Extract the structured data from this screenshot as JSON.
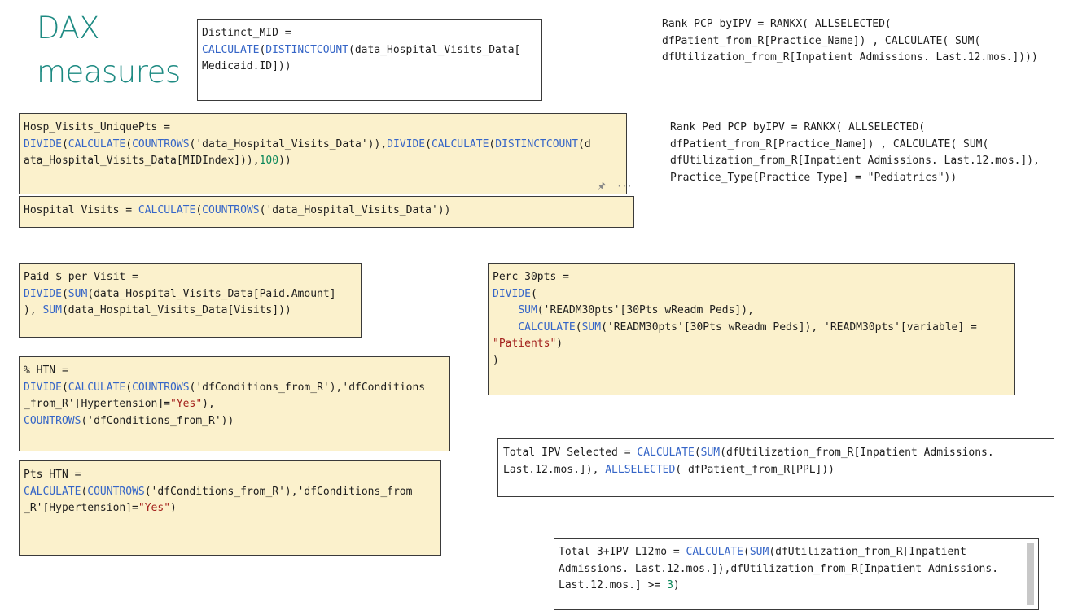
{
  "page": {
    "title_line1": "DAX",
    "title_line2": "measures"
  },
  "measures": [
    {
      "id": "distinct-mid",
      "lines": [
        [
          {
            "t": "Distinct_MID ="
          }
        ],
        [
          {
            "t": "CALCULATE",
            "c": "fn"
          },
          {
            "t": "("
          },
          {
            "t": "DISTINCTCOUNT",
            "c": "fn"
          },
          {
            "t": "(data_Hospital_Visits_Data["
          }
        ],
        [
          {
            "t": "Medicaid.ID]))"
          }
        ]
      ]
    },
    {
      "id": "rank-pcp",
      "lines": [
        [
          {
            "t": "Rank PCP byIPV = RANKX( ALLSELECTED("
          }
        ],
        [
          {
            "t": "dfPatient_from_R[Practice_Name]) , CALCULATE( SUM("
          }
        ],
        [
          {
            "t": "dfUtilization_from_R[Inpatient Admissions. Last.12.mos.])))"
          }
        ]
      ]
    },
    {
      "id": "hosp-visits-uniquepts",
      "lines": [
        [
          {
            "t": "Hosp_Visits_UniquePts ="
          }
        ],
        [
          {
            "t": "DIVIDE",
            "c": "fn"
          },
          {
            "t": "("
          },
          {
            "t": "CALCULATE",
            "c": "fn"
          },
          {
            "t": "("
          },
          {
            "t": "COUNTROWS",
            "c": "fn"
          },
          {
            "t": "('data_Hospital_Visits_Data')),"
          },
          {
            "t": "DIVIDE",
            "c": "fn"
          },
          {
            "t": "("
          },
          {
            "t": "CALCULATE",
            "c": "fn"
          },
          {
            "t": "("
          },
          {
            "t": "DISTINCTCOUNT",
            "c": "fn"
          },
          {
            "t": "(d"
          }
        ],
        [
          {
            "t": "ata_Hospital_Visits_Data[MIDIndex])),"
          },
          {
            "t": "100",
            "c": "num"
          },
          {
            "t": "))"
          }
        ]
      ]
    },
    {
      "id": "rank-ped-pcp",
      "lines": [
        [
          {
            "t": "Rank Ped PCP byIPV = RANKX( ALLSELECTED("
          }
        ],
        [
          {
            "t": "dfPatient_from_R[Practice_Name]) , CALCULATE( SUM("
          }
        ],
        [
          {
            "t": "dfUtilization_from_R[Inpatient Admissions. Last.12.mos.]),"
          }
        ],
        [
          {
            "t": "Practice_Type[Practice Type] = \"Pediatrics\"))"
          }
        ]
      ]
    },
    {
      "id": "hospital-visits",
      "lines": [
        [
          {
            "t": "Hospital Visits = "
          },
          {
            "t": "CALCULATE",
            "c": "fn"
          },
          {
            "t": "("
          },
          {
            "t": "COUNTROWS",
            "c": "fn"
          },
          {
            "t": "('data_Hospital_Visits_Data'))"
          }
        ]
      ]
    },
    {
      "id": "paid-per-visit",
      "lines": [
        [
          {
            "t": "Paid $ per Visit ="
          }
        ],
        [
          {
            "t": "DIVIDE",
            "c": "fn"
          },
          {
            "t": "("
          },
          {
            "t": "SUM",
            "c": "fn"
          },
          {
            "t": "(data_Hospital_Visits_Data[Paid.Amount]"
          }
        ],
        [
          {
            "t": "), "
          },
          {
            "t": "SUM",
            "c": "fn"
          },
          {
            "t": "(data_Hospital_Visits_Data[Visits]))"
          }
        ]
      ]
    },
    {
      "id": "perc-30pts",
      "lines": [
        [
          {
            "t": "Perc 30pts ="
          }
        ],
        [
          {
            "t": "DIVIDE",
            "c": "fn"
          },
          {
            "t": "("
          }
        ],
        [
          {
            "t": "    "
          },
          {
            "t": "SUM",
            "c": "fn"
          },
          {
            "t": "('READM30pts'[30Pts wReadm Peds]),"
          }
        ],
        [
          {
            "t": "    "
          },
          {
            "t": "CALCULATE",
            "c": "fn"
          },
          {
            "t": "("
          },
          {
            "t": "SUM",
            "c": "fn"
          },
          {
            "t": "('READM30pts'[30Pts wReadm Peds]), 'READM30pts'[variable] ="
          }
        ],
        [
          {
            "t": "\"Patients\"",
            "c": "str"
          },
          {
            "t": ")"
          }
        ],
        [
          {
            "t": ")"
          }
        ]
      ]
    },
    {
      "id": "pct-htn",
      "lines": [
        [
          {
            "t": "% HTN ="
          }
        ],
        [
          {
            "t": "DIVIDE",
            "c": "fn"
          },
          {
            "t": "("
          },
          {
            "t": "CALCULATE",
            "c": "fn"
          },
          {
            "t": "("
          },
          {
            "t": "COUNTROWS",
            "c": "fn"
          },
          {
            "t": "('dfConditions_from_R'),'dfConditions"
          }
        ],
        [
          {
            "t": "_from_R'[Hypertension]="
          },
          {
            "t": "\"Yes\"",
            "c": "str"
          },
          {
            "t": "),"
          }
        ],
        [
          {
            "t": "COUNTROWS",
            "c": "fn"
          },
          {
            "t": "('dfConditions_from_R'))"
          }
        ]
      ]
    },
    {
      "id": "total-ipv-selected",
      "lines": [
        [
          {
            "t": "Total IPV Selected = "
          },
          {
            "t": "CALCULATE",
            "c": "fn"
          },
          {
            "t": "("
          },
          {
            "t": "SUM",
            "c": "fn"
          },
          {
            "t": "(dfUtilization_from_R[Inpatient Admissions."
          }
        ],
        [
          {
            "t": "Last.12.mos.]), "
          },
          {
            "t": "ALLSELECTED",
            "c": "fn"
          },
          {
            "t": "( dfPatient_from_R[PPL]))"
          }
        ]
      ]
    },
    {
      "id": "pts-htn",
      "lines": [
        [
          {
            "t": "Pts HTN ="
          }
        ],
        [
          {
            "t": "CALCULATE",
            "c": "fn"
          },
          {
            "t": "("
          },
          {
            "t": "COUNTROWS",
            "c": "fn"
          },
          {
            "t": "('dfConditions_from_R'),'dfConditions_from"
          }
        ],
        [
          {
            "t": "_R'[Hypertension]="
          },
          {
            "t": "\"Yes\"",
            "c": "str"
          },
          {
            "t": ")"
          }
        ]
      ]
    },
    {
      "id": "total-3-ipv",
      "lines": [
        [
          {
            "t": "Total 3+IPV L12mo = "
          },
          {
            "t": "CALCULATE",
            "c": "fn"
          },
          {
            "t": "("
          },
          {
            "t": "SUM",
            "c": "fn"
          },
          {
            "t": "(dfUtilization_from_R[Inpatient"
          }
        ],
        [
          {
            "t": "Admissions. Last.12.mos.]),dfUtilization_from_R[Inpatient Admissions."
          }
        ],
        [
          {
            "t": "Last.12.mos.] >= "
          },
          {
            "t": "3",
            "c": "num"
          },
          {
            "t": ")"
          }
        ]
      ]
    }
  ]
}
